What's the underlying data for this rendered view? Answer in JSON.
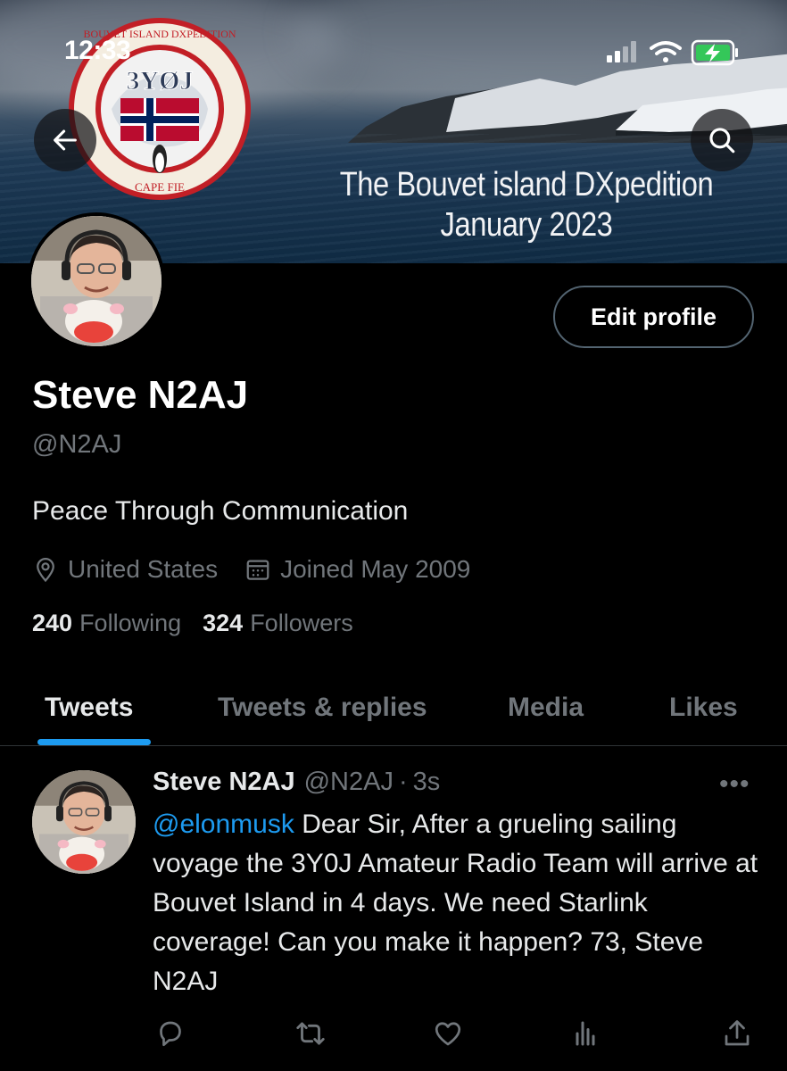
{
  "status_bar": {
    "time": "12:33",
    "icons": [
      "signal-icon",
      "wifi-icon",
      "battery-charging-icon"
    ]
  },
  "banner": {
    "title_line1": "The Bouvet island DXpedition",
    "title_line2": "January 2023",
    "logo": {
      "callsign": "3YØJ",
      "ring_top": "BOUVET ISLAND DXPEDITION",
      "ring_bottom": "CAPE FIE"
    }
  },
  "nav": {
    "back_icon": "arrow-left-icon",
    "search_icon": "search-icon"
  },
  "profile": {
    "edit_button": "Edit profile",
    "display_name": "Steve N2AJ",
    "handle": "@N2AJ",
    "bio": "Peace Through Communication",
    "location": "United States",
    "joined": "Joined May 2009",
    "following_count": "240",
    "following_label": "Following",
    "followers_count": "324",
    "followers_label": "Followers"
  },
  "tabs": [
    {
      "label": "Tweets",
      "active": true
    },
    {
      "label": "Tweets & replies",
      "active": false
    },
    {
      "label": "Media",
      "active": false
    },
    {
      "label": "Likes",
      "active": false
    }
  ],
  "tweet": {
    "author_name": "Steve N2AJ",
    "author_handle": "@N2AJ",
    "separator": "·",
    "time": "3s",
    "mention": "@elonmusk",
    "body": " Dear Sir, After a grueling sailing voyage the 3Y0J Amateur Radio Team will arrive at Bouvet Island in 4 days. We need Starlink coverage! Can you make it happen? 73, Steve N2AJ",
    "more": "•••",
    "actions": [
      "reply-icon",
      "retweet-icon",
      "like-icon",
      "analytics-icon",
      "share-icon"
    ]
  },
  "colors": {
    "accent": "#1d9bf0",
    "background": "#000000",
    "secondary_text": "#71767b",
    "primary_text": "#e7e9ea"
  }
}
